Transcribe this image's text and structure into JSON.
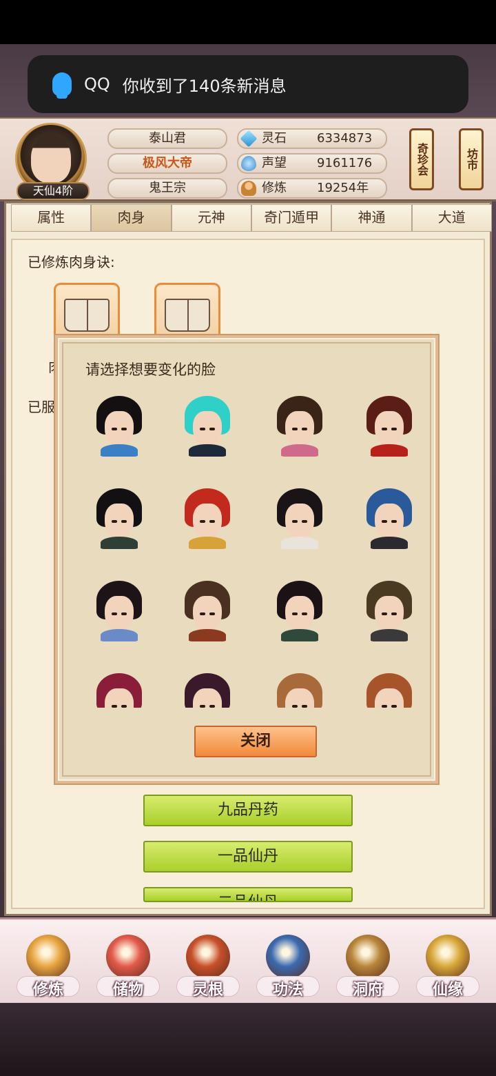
{
  "notification": {
    "app": "QQ",
    "message": "你收到了140条新消息"
  },
  "player": {
    "name": "泰山君",
    "title": "极风大帝",
    "sect": "鬼王宗",
    "rank": "天仙4阶"
  },
  "stats": [
    {
      "label": "灵石",
      "value": "6334873",
      "icon": "spirit-stone-icon"
    },
    {
      "label": "声望",
      "value": "9161176",
      "icon": "reputation-icon"
    },
    {
      "label": "修炼",
      "value": "19254年",
      "icon": "cultivation-icon"
    }
  ],
  "side_buttons": [
    {
      "label": "奇珍会"
    },
    {
      "label": "坊市"
    }
  ],
  "tabs": [
    {
      "label": "属性",
      "active": false
    },
    {
      "label": "肉身",
      "active": true
    },
    {
      "label": "元神",
      "active": false
    },
    {
      "label": "奇门遁甲",
      "active": false
    },
    {
      "label": "神通",
      "active": false
    },
    {
      "label": "大道",
      "active": false
    }
  ],
  "content": {
    "cultivated_title": "已修炼肉身诀:",
    "book_label_partial": "肉",
    "consumed_title_partial": "已服",
    "pill_buttons": [
      "九品丹药",
      "一品仙丹",
      "二品仙丹"
    ]
  },
  "dialog": {
    "title": "请选择想要变化的脸",
    "close_label": "关闭",
    "faces": [
      {
        "hair": "#141012",
        "collar": "#3b7fc4"
      },
      {
        "hair": "#2fd0c8",
        "collar": "#1e2a3a"
      },
      {
        "hair": "#3a2418",
        "collar": "#d06a8a"
      },
      {
        "hair": "#5a1e16",
        "collar": "#b8211a"
      },
      {
        "hair": "#121012",
        "collar": "#2f3f36"
      },
      {
        "hair": "#c22a1e",
        "collar": "#d8a23a"
      },
      {
        "hair": "#1a1416",
        "collar": "#e8e4dc"
      },
      {
        "hair": "#2b5a9a",
        "collar": "#2a2a30"
      },
      {
        "hair": "#1c1416",
        "collar": "#6a8ac8"
      },
      {
        "hair": "#4a3020",
        "collar": "#8a3a1e"
      },
      {
        "hair": "#1a1214",
        "collar": "#2f4a3a"
      },
      {
        "hair": "#4a3a22",
        "collar": "#3a3a3a"
      },
      {
        "hair": "#8a1e3a",
        "collar": "#f2c26a"
      },
      {
        "hair": "#3a1a2a",
        "collar": "#3a1a2a"
      },
      {
        "hair": "#a86a3a",
        "collar": "#e8d8c0"
      },
      {
        "hair": "#a8542a",
        "collar": "#e8d8c0"
      }
    ]
  },
  "bottom_nav": [
    {
      "label": "修炼",
      "color": "#e8a640"
    },
    {
      "label": "储物",
      "color": "#e25a4a"
    },
    {
      "label": "灵根",
      "color": "#c8502a"
    },
    {
      "label": "功法",
      "color": "#3a6ab0"
    },
    {
      "label": "洞府",
      "color": "#b8863a"
    },
    {
      "label": "仙缘",
      "color": "#d8a83a"
    }
  ]
}
